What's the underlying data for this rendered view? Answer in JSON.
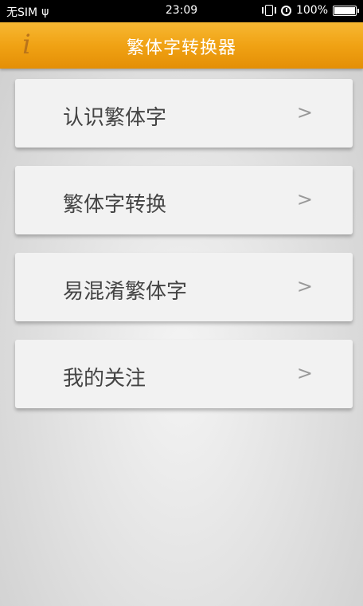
{
  "status_bar": {
    "carrier": "无SIM",
    "time": "23:09",
    "battery": "100%",
    "battery_level": 1.0,
    "icons": [
      "usb-icon",
      "vibrate-icon",
      "alarm-icon",
      "battery-icon"
    ]
  },
  "header": {
    "title": "繁体字转换器",
    "info_glyph": "i",
    "accent_color": "#f0a214"
  },
  "menu": {
    "chevron": ">",
    "items": [
      {
        "label": "认识繁体字"
      },
      {
        "label": "繁体字转换"
      },
      {
        "label": "易混淆繁体字"
      },
      {
        "label": "我的关注"
      }
    ]
  }
}
